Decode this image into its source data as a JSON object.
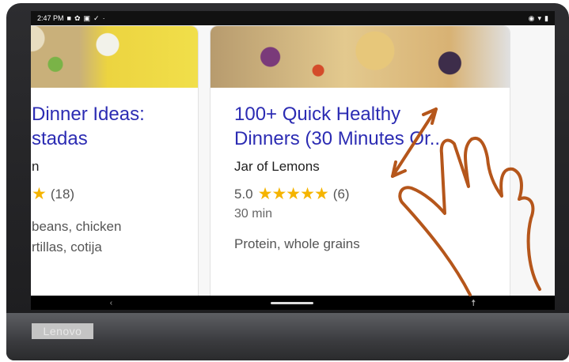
{
  "status_bar": {
    "time": "2:47 PM",
    "left_icons": [
      "notification-icon",
      "settings-icon",
      "photo-icon",
      "check-icon",
      "dot-icon"
    ],
    "right_icons": [
      "location-icon",
      "wifi-icon",
      "battery-icon"
    ]
  },
  "device": {
    "brand": "Lenovo"
  },
  "cards": [
    {
      "title_lines": [
        "Dinner Ideas:",
        "stadas"
      ],
      "source": "n",
      "rating_value": "",
      "stars": "★",
      "rating_count": "(18)",
      "time": "",
      "ingredients_lines": [
        "beans, chicken",
        "rtillas, cotija"
      ]
    },
    {
      "title_lines": [
        "100+ Quick Healthy",
        "Dinners (30 Minutes Or..."
      ],
      "source": "Jar of Lemons",
      "rating_value": "5.0",
      "stars": "★★★★★",
      "rating_count": "(6)",
      "time": "30 min",
      "ingredients_lines": [
        "Protein, whole grains"
      ]
    }
  ],
  "navigation": {
    "back_symbol": "‹",
    "accessibility_symbol": "☨"
  },
  "colors": {
    "title": "#2c2cb3",
    "stars": "#f5b400",
    "gesture": "#b5561b"
  }
}
